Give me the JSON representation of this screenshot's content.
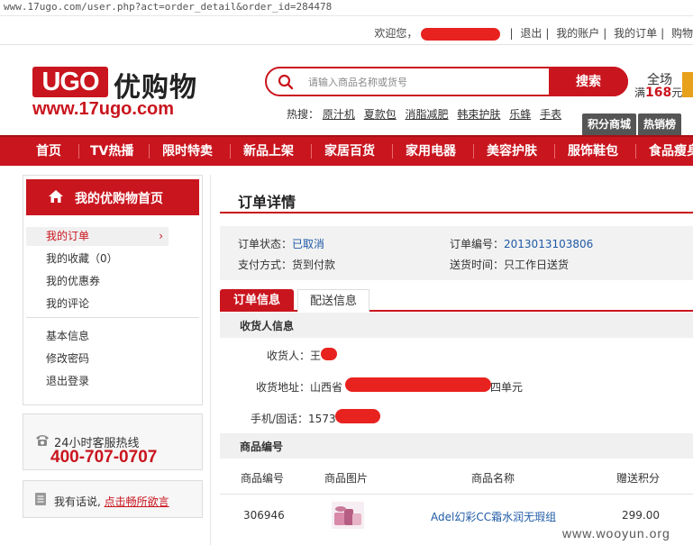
{
  "browser": {
    "url": "www.17ugo.com/user.php?act=order_detail&order_id=284478"
  },
  "topbar": {
    "welcome": "欢迎您，",
    "links": [
      "退出",
      "我的账户",
      "我的订单",
      "购物"
    ]
  },
  "header": {
    "logo_ugo": "UGO",
    "logo_cn": "优购物",
    "logo_url": "www.17ugo.com",
    "search_placeholder": "请输入商品名称或货号",
    "search_button": "搜索",
    "hot_label": "热搜：",
    "hot_terms": [
      "原汁机",
      "夏款包",
      "消脂减肥",
      "韩束护肤",
      "乐蜂",
      "手表"
    ],
    "promo_line1": "全场",
    "promo_line2_prefix": "满",
    "promo_amount": "168",
    "promo_line2_suffix": "元",
    "promo_tabs": [
      "积分商城",
      "热销榜"
    ]
  },
  "nav": [
    "首页",
    "TV热播",
    "限时特卖",
    "新品上架",
    "家居百货",
    "家用电器",
    "美容护肤",
    "服饰鞋包",
    "食品瘦身"
  ],
  "sidebar": {
    "home": "我的优购物首页",
    "items": [
      "我的订单",
      "我的收藏（0）",
      "我的优惠券",
      "我的评论"
    ],
    "items2": [
      "基本信息",
      "修改密码",
      "退出登录"
    ],
    "hotline_label": "24小时客服热线",
    "hotline_number": "400-707-0707",
    "feedback_text": "我有话说,",
    "feedback_link": "点击畅所欲言"
  },
  "main": {
    "title": "订单详情",
    "status_label": "订单状态：",
    "status_value": "已取消",
    "order_no_label": "订单编号：",
    "order_no_value": "2013013103806",
    "pay_label": "支付方式：",
    "pay_value": "货到付款",
    "delivery_label": "送货时间：",
    "delivery_value": "只工作日送货",
    "tabs": [
      "订单信息",
      "配送信息"
    ],
    "consignee_section": "收货人信息",
    "consignee_label": "收货人：",
    "consignee_value": "王",
    "address_label": "收货地址：",
    "address_prefix": "山西省",
    "address_suffix": "四单元",
    "phone_label": "手机/固话：",
    "phone_prefix": "1573",
    "goods_section": "商品编号",
    "table_headers": [
      "商品编号",
      "商品图片",
      "商品名称",
      "赠送积分"
    ],
    "rows": [
      {
        "sku": "306946",
        "name": "Adel幻彩CC霜水润无瑕组",
        "points": "299.00"
      }
    ]
  },
  "watermark": "www.wooyun.org",
  "colors": {
    "brand_red": "#c9151e",
    "link_blue": "#1f5aa6",
    "redaction": "#e8231f"
  }
}
